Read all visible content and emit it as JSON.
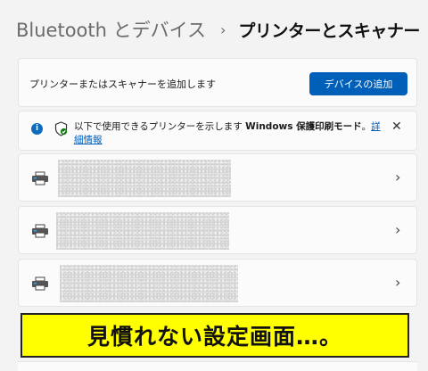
{
  "breadcrumb": {
    "parent": "Bluetooth とデバイス",
    "separator": "›",
    "current": "プリンターとスキャナー"
  },
  "add_device": {
    "label": "プリンターまたはスキャナーを追加します",
    "button_label": "デバイスの追加",
    "button_color": "#005fb8"
  },
  "info_bar": {
    "info_icon": "i",
    "text_prefix": "以下で使用できるプリンターを示します ",
    "text_bold": "Windows 保護印刷モード",
    "text_suffix": "。",
    "link_label": "詳細情報",
    "close_label": "✕"
  },
  "printers": [
    {
      "icon": "printer-icon",
      "name_redacted": true
    },
    {
      "icon": "printer-icon",
      "name_redacted": true
    },
    {
      "icon": "printer-icon",
      "name_redacted": true
    }
  ],
  "chevron": "›",
  "banner": {
    "text": "見慣れない設定画面…。",
    "background": "#ffff00"
  }
}
